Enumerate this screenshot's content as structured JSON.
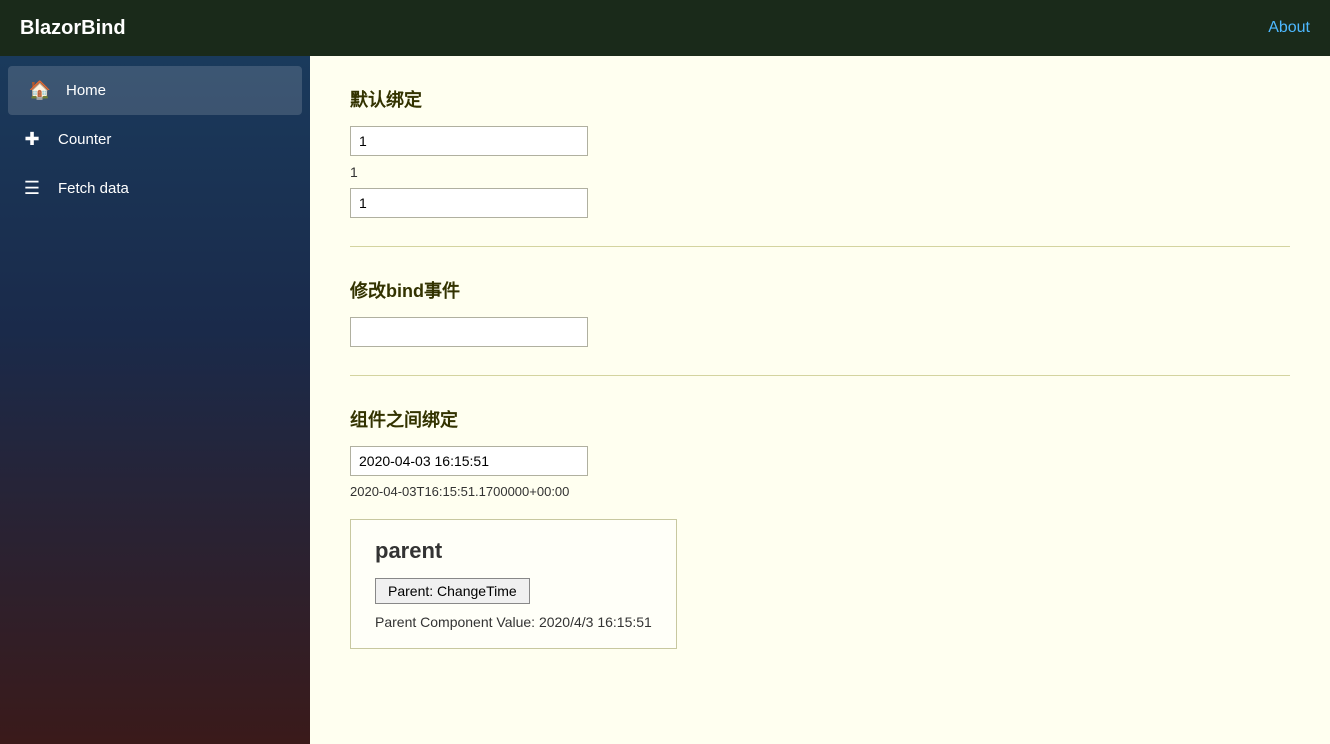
{
  "navbar": {
    "brand": "BlazorBind",
    "about_label": "About"
  },
  "sidebar": {
    "items": [
      {
        "id": "home",
        "label": "Home",
        "icon": "🏠",
        "active": true
      },
      {
        "id": "counter",
        "label": "Counter",
        "icon": "+",
        "active": false
      },
      {
        "id": "fetch-data",
        "label": "Fetch data",
        "icon": "≡",
        "active": false
      }
    ]
  },
  "content": {
    "section1": {
      "title": "默认绑定",
      "input1_value": "1",
      "value_display": "1",
      "input2_value": "1"
    },
    "section2": {
      "title": "修改bind事件",
      "input_value": ""
    },
    "section3": {
      "title": "组件之间绑定",
      "datetime_input": "2020-04-03 16:15:51",
      "datetime_full": "2020-04-03T16:15:51.1700000+00:00",
      "parent_box": {
        "title": "parent",
        "button_label": "Parent: ChangeTime",
        "value_label": "Parent Component Value: 2020/4/3 16:15:51"
      }
    }
  }
}
